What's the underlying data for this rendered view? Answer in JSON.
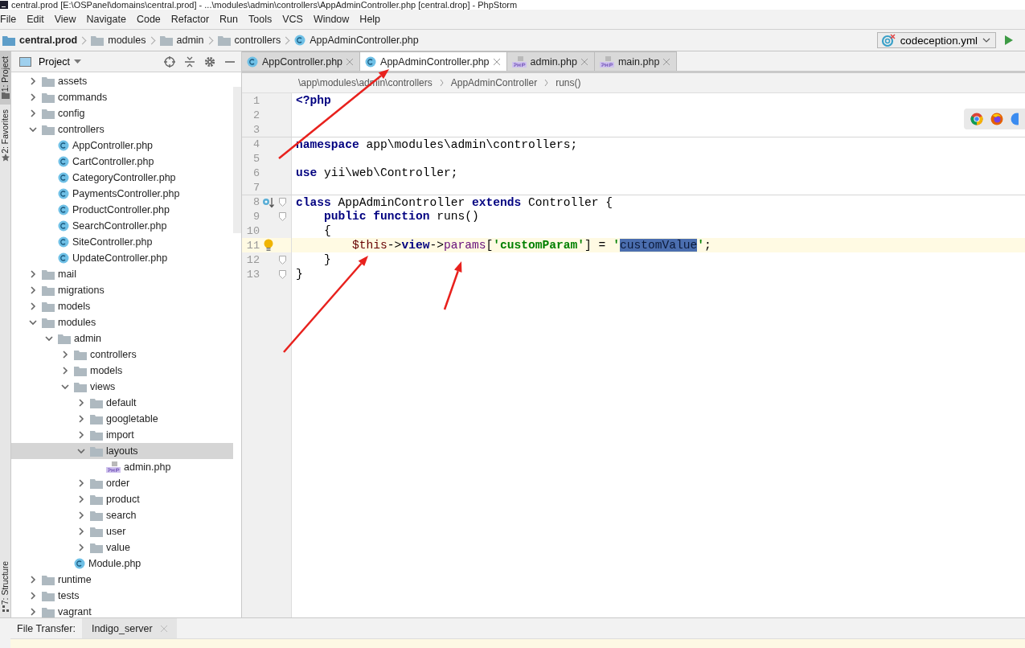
{
  "window": {
    "title": "central.prod [E:\\OSPanel\\domains\\central.prod] - ...\\modules\\admin\\controllers\\AppAdminController.php [central.drop] - PhpStorm"
  },
  "menu": [
    "File",
    "Edit",
    "View",
    "Navigate",
    "Code",
    "Refactor",
    "Run",
    "Tools",
    "VCS",
    "Window",
    "Help"
  ],
  "navigation_bar": {
    "breadcrumbs": [
      {
        "label": "central.prod",
        "kind": "project"
      },
      {
        "label": "modules",
        "kind": "folder"
      },
      {
        "label": "admin",
        "kind": "folder"
      },
      {
        "label": "controllers",
        "kind": "folder"
      },
      {
        "label": "AppAdminController.php",
        "kind": "class"
      }
    ],
    "run_configuration": "codeception.yml"
  },
  "tool_window_stripe": [
    {
      "label": "1: Project",
      "selected": true,
      "kind": "project"
    },
    {
      "label": "2: Favorites",
      "selected": false,
      "kind": "favorites"
    },
    {
      "label": "7: Structure",
      "selected": false,
      "kind": "structure"
    }
  ],
  "project_panel": {
    "title": "Project",
    "tree": [
      {
        "name": "assets",
        "kind": "folder",
        "expanded": false,
        "selected": false
      },
      {
        "name": "commands",
        "kind": "folder",
        "expanded": false,
        "selected": false
      },
      {
        "name": "config",
        "kind": "folder",
        "expanded": false,
        "selected": false
      },
      {
        "name": "controllers",
        "kind": "folder",
        "expanded": true,
        "selected": false,
        "children": [
          {
            "name": "AppController.php",
            "kind": "class",
            "selected": false
          },
          {
            "name": "CartController.php",
            "kind": "class",
            "selected": false
          },
          {
            "name": "CategoryController.php",
            "kind": "class",
            "selected": false
          },
          {
            "name": "PaymentsController.php",
            "kind": "class",
            "selected": false
          },
          {
            "name": "ProductController.php",
            "kind": "class",
            "selected": false
          },
          {
            "name": "SearchController.php",
            "kind": "class",
            "selected": false
          },
          {
            "name": "SiteController.php",
            "kind": "class",
            "selected": false
          },
          {
            "name": "UpdateController.php",
            "kind": "class",
            "selected": false
          }
        ]
      },
      {
        "name": "mail",
        "kind": "folder",
        "expanded": false,
        "selected": false
      },
      {
        "name": "migrations",
        "kind": "folder",
        "expanded": false,
        "selected": false
      },
      {
        "name": "models",
        "kind": "folder",
        "expanded": false,
        "selected": false
      },
      {
        "name": "modules",
        "kind": "folder",
        "expanded": true,
        "selected": false,
        "children": [
          {
            "name": "admin",
            "kind": "folder",
            "expanded": true,
            "selected": false,
            "children": [
              {
                "name": "controllers",
                "kind": "folder",
                "expanded": false,
                "selected": false
              },
              {
                "name": "models",
                "kind": "folder",
                "expanded": false,
                "selected": false
              },
              {
                "name": "views",
                "kind": "folder",
                "expanded": true,
                "selected": false,
                "children": [
                  {
                    "name": "default",
                    "kind": "folder",
                    "expanded": false,
                    "selected": false
                  },
                  {
                    "name": "googletable",
                    "kind": "folder",
                    "expanded": false,
                    "selected": false
                  },
                  {
                    "name": "import",
                    "kind": "folder",
                    "expanded": false,
                    "selected": false
                  },
                  {
                    "name": "layouts",
                    "kind": "folder",
                    "expanded": true,
                    "selected": true,
                    "children": [
                      {
                        "name": "admin.php",
                        "kind": "php",
                        "selected": false
                      }
                    ]
                  },
                  {
                    "name": "order",
                    "kind": "folder",
                    "expanded": false,
                    "selected": false
                  },
                  {
                    "name": "product",
                    "kind": "folder",
                    "expanded": false,
                    "selected": false
                  },
                  {
                    "name": "search",
                    "kind": "folder",
                    "expanded": false,
                    "selected": false
                  },
                  {
                    "name": "user",
                    "kind": "folder",
                    "expanded": false,
                    "selected": false
                  },
                  {
                    "name": "value",
                    "kind": "folder",
                    "expanded": false,
                    "selected": false
                  }
                ]
              },
              {
                "name": "Module.php",
                "kind": "class",
                "selected": false
              }
            ]
          }
        ]
      },
      {
        "name": "runtime",
        "kind": "folder",
        "expanded": false,
        "selected": false
      },
      {
        "name": "tests",
        "kind": "folder",
        "expanded": false,
        "selected": false
      },
      {
        "name": "vagrant",
        "kind": "folder",
        "expanded": false,
        "selected": false
      }
    ]
  },
  "editor": {
    "tabs": [
      {
        "label": "AppController.php",
        "kind": "class",
        "selected": false
      },
      {
        "label": "AppAdminController.php",
        "kind": "class",
        "selected": true
      },
      {
        "label": "admin.php",
        "kind": "php",
        "selected": false
      },
      {
        "label": "main.php",
        "kind": "php",
        "selected": false
      }
    ],
    "breadcrumbs": [
      "\\app\\modules\\admin\\controllers",
      "AppAdminController",
      "runs()"
    ],
    "lines": [
      {
        "number": "1",
        "current": false,
        "fold": false,
        "override": false,
        "bulb": false,
        "tokens": [
          {
            "text": "<?php",
            "kind": "keyword"
          }
        ]
      },
      {
        "number": "2",
        "current": false,
        "fold": false,
        "override": false,
        "bulb": false
      },
      {
        "number": "3",
        "current": false,
        "fold": false,
        "override": false,
        "bulb": false
      },
      {
        "number": "4",
        "current": false,
        "fold": false,
        "override": false,
        "bulb": false,
        "tokens": [
          {
            "text": "namespace",
            "kind": "keyword"
          },
          {
            "text": " app\\modules\\admin\\controllers;",
            "kind": "plain"
          }
        ]
      },
      {
        "number": "5",
        "current": false,
        "fold": false,
        "override": false,
        "bulb": false
      },
      {
        "number": "6",
        "current": false,
        "fold": false,
        "override": false,
        "bulb": false,
        "tokens": [
          {
            "text": "use",
            "kind": "keyword"
          },
          {
            "text": " yii\\web\\Controller;",
            "kind": "plain"
          }
        ]
      },
      {
        "number": "7",
        "current": false,
        "fold": false,
        "override": false,
        "bulb": false
      },
      {
        "number": "8",
        "current": false,
        "fold": true,
        "override": true,
        "bulb": false,
        "tokens": [
          {
            "text": "class",
            "kind": "keyword"
          },
          {
            "text": " AppAdminController ",
            "kind": "plain"
          },
          {
            "text": "extends",
            "kind": "keyword"
          },
          {
            "text": " Controller {",
            "kind": "plain"
          }
        ]
      },
      {
        "number": "9",
        "current": false,
        "fold": true,
        "override": false,
        "bulb": false,
        "tokens": [
          {
            "text": "    public function",
            "kind": "keyword"
          },
          {
            "text": " runs()",
            "kind": "plain"
          }
        ]
      },
      {
        "number": "10",
        "current": false,
        "fold": false,
        "override": false,
        "bulb": false,
        "tokens": [
          {
            "text": "    {",
            "kind": "plain"
          }
        ]
      },
      {
        "number": "11",
        "current": true,
        "fold": false,
        "override": false,
        "bulb": true,
        "tokens": [
          {
            "text": "        $this",
            "kind": "variable"
          },
          {
            "text": "->",
            "kind": "plain"
          },
          {
            "text": "view",
            "kind": "field"
          },
          {
            "text": "->",
            "kind": "plain"
          },
          {
            "text": "params",
            "kind": "member"
          },
          {
            "text": "[",
            "kind": "plain"
          },
          {
            "text": "'customParam'",
            "kind": "string"
          },
          {
            "text": "] = ",
            "kind": "plain"
          },
          {
            "text": "'",
            "kind": "string"
          },
          {
            "text": "customValue",
            "kind": "selected"
          },
          {
            "text": "'",
            "kind": "string"
          },
          {
            "text": ";",
            "kind": "plain"
          }
        ]
      },
      {
        "number": "12",
        "current": false,
        "fold": true,
        "override": false,
        "bulb": false,
        "tokens": [
          {
            "text": "    }",
            "kind": "plain"
          }
        ]
      },
      {
        "number": "13",
        "current": false,
        "fold": true,
        "override": false,
        "bulb": false,
        "tokens": [
          {
            "text": "}",
            "kind": "plain"
          }
        ]
      }
    ]
  },
  "bottom_bar": {
    "label": "File Transfer:",
    "tabs": [
      {
        "label": "Indigo_server"
      }
    ]
  }
}
